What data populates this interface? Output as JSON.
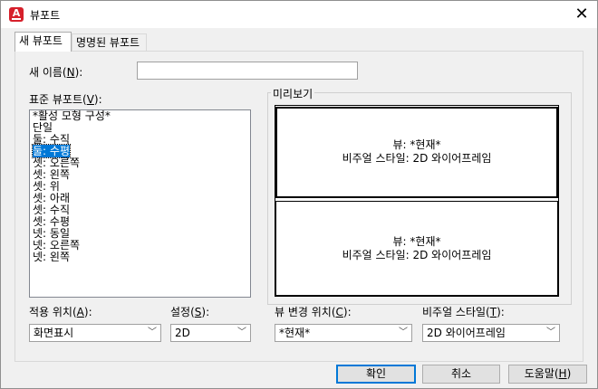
{
  "window": {
    "title": "뷰포트",
    "icon": "autocad-a-icon",
    "close": "✕"
  },
  "tabs": [
    {
      "label": "새 뷰포트"
    },
    {
      "label": "명명된 뷰포트"
    }
  ],
  "new_name": {
    "label": "새 이름(N):",
    "value": ""
  },
  "standard": {
    "label": "표준 뷰포트(V):",
    "items": [
      "*활성 모형 구성*",
      "단일",
      "둘: 수직",
      "둘: 수평",
      "셋: 오른쪽",
      "셋: 왼쪽",
      "셋: 위",
      "셋: 아래",
      "셋: 수직",
      "셋: 수평",
      "넷: 동일",
      "넷: 오른쪽",
      "넷: 왼쪽"
    ],
    "selected_index": 3
  },
  "preview": {
    "caption": "미리보기",
    "top": {
      "line1": "뷰: *현재*",
      "line2": "비주얼 스타일: 2D 와이어프레임"
    },
    "bottom": {
      "line1": "뷰: *현재*",
      "line2": "비주얼 스타일: 2D 와이어프레임"
    }
  },
  "apply_to": {
    "label": "적용 위치(A):",
    "value": "화면표시"
  },
  "setup": {
    "label": "설정(S):",
    "value": "2D"
  },
  "change_view": {
    "label": "뷰 변경 위치(C):",
    "value": "*현재*"
  },
  "visual_style": {
    "label": "비주얼 스타일(T):",
    "value": "2D 와이어프레임"
  },
  "buttons": {
    "ok": "확인",
    "cancel": "취소",
    "help": "도움말(H)"
  }
}
